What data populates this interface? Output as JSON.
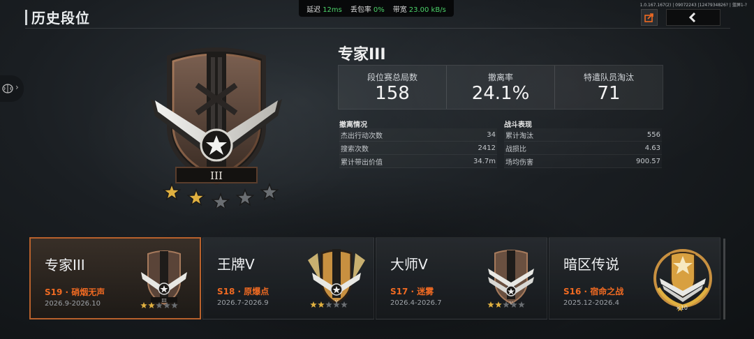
{
  "header": {
    "title": "历史段位",
    "version": "1.0.167.167(2) | 09072243 |1247934826? | 蓝屏1-?"
  },
  "network": {
    "latency_label": "延迟",
    "latency_value": "12ms",
    "loss_label": "丢包率",
    "loss_value": "0%",
    "bandwidth_label": "带宽",
    "bandwidth_value": "23.00 kB/s"
  },
  "current": {
    "rank_name": "专家III",
    "badge_numeral": "III",
    "stars_filled": 2,
    "stars_total": 5,
    "stats": [
      {
        "label": "段位赛总局数",
        "value": "158"
      },
      {
        "label": "撤离率",
        "value": "24.1%"
      },
      {
        "label": "特遣队员淘汰",
        "value": "71"
      }
    ],
    "evac": {
      "title": "撤离情况",
      "rows": [
        {
          "label": "杰出行动次数",
          "value": "34"
        },
        {
          "label": "搜索次数",
          "value": "2412"
        },
        {
          "label": "累计带出价值",
          "value": "34.7m"
        }
      ]
    },
    "combat": {
      "title": "战斗表现",
      "rows": [
        {
          "label": "累计淘汰",
          "value": "556"
        },
        {
          "label": "战损比",
          "value": "4.63"
        },
        {
          "label": "场均伤害",
          "value": "900.57"
        }
      ]
    }
  },
  "seasons": [
    {
      "rank": "专家III",
      "season": "S19 · 硝烟无声",
      "dates": "2026.9-2026.10",
      "stars_filled": 2,
      "tier": "expert",
      "active": true
    },
    {
      "rank": "王牌V",
      "season": "S18 · 原爆点",
      "dates": "2026.7-2026.9",
      "stars_filled": 2,
      "tier": "ace",
      "active": false
    },
    {
      "rank": "大师V",
      "season": "S17 · 迷雾",
      "dates": "2026.4-2026.7",
      "stars_filled": 2,
      "tier": "master",
      "active": false
    },
    {
      "rank": "暗区传说",
      "season": "S16 · 宿命之战",
      "dates": "2025.12-2026.4",
      "stars_filled": 1,
      "tier": "legend",
      "active": false,
      "star_count_label": "×10"
    }
  ],
  "colors": {
    "accent_orange": "#f06a22",
    "active_border": "#b8612c",
    "net_green": "#4cd36a",
    "star_gold": "#e0b040",
    "star_grey": "#6a6e72"
  },
  "icons": {
    "share": "share-icon",
    "back": "back-arrow-icon",
    "side": "collapse-chevron-icon"
  }
}
